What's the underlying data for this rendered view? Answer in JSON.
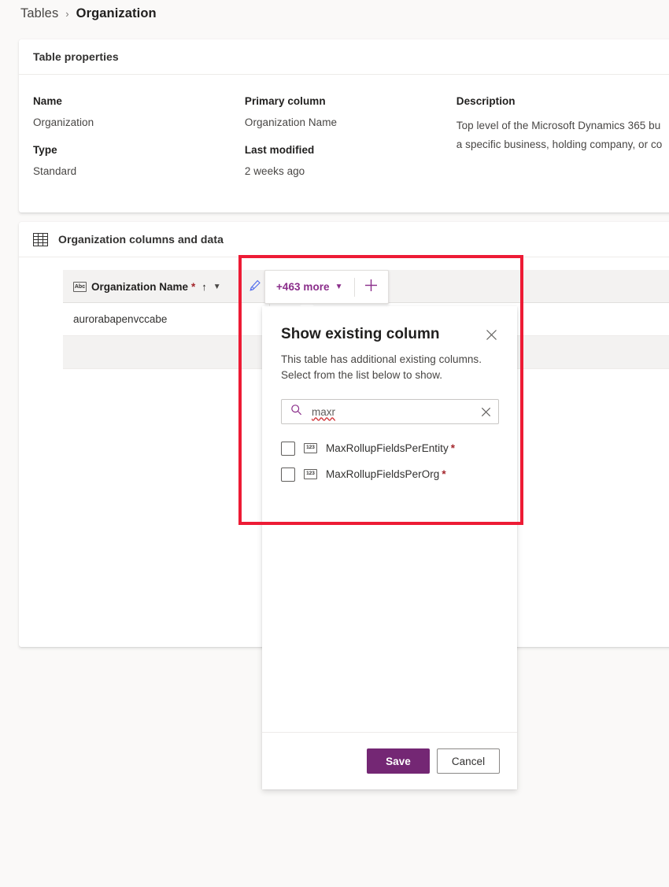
{
  "breadcrumb": {
    "parent": "Tables",
    "separator": "›",
    "current": "Organization"
  },
  "properties_card": {
    "title": "Table properties",
    "columns": [
      {
        "label": "Name",
        "value": "Organization",
        "label2": "Type",
        "value2": "Standard"
      },
      {
        "label": "Primary column",
        "value": "Organization Name",
        "label2": "Last modified",
        "value2": "2 weeks ago"
      }
    ],
    "description_label": "Description",
    "description_value": "Top level of the Microsoft Dynamics 365 bu\na specific business, holding company, or co"
  },
  "grid_card": {
    "title": "Organization columns and data",
    "table_icon": "table-icon",
    "header": {
      "name_icon": "abc-text-icon",
      "name_label": "Organization Name",
      "required_marker": "*",
      "sort_indicator": "↑",
      "chevron": "⌄",
      "edit_icon": "edit-pencil-icon"
    },
    "rows": [
      {
        "name": "aurorabapenvccabe"
      },
      {
        "name": ""
      }
    ]
  },
  "more_pill": {
    "label": "+463 more",
    "chevron_icon": "chevron-down-icon",
    "add_icon": "plus-icon"
  },
  "flyout": {
    "title": "Show existing column",
    "close_icon": "close-icon",
    "subtitle": "This table has additional existing columns. Select from the list below to show.",
    "search": {
      "icon": "search-icon",
      "value": "maxr",
      "placeholder": "Search",
      "clear_icon": "clear-icon"
    },
    "columns": [
      {
        "name": "MaxRollupFieldsPerEntity",
        "required_marker": "*",
        "type_icon": "number-123-icon",
        "checked": false
      },
      {
        "name": "MaxRollupFieldsPerOrg",
        "required_marker": "*",
        "type_icon": "number-123-icon",
        "checked": false
      }
    ],
    "save_label": "Save",
    "cancel_label": "Cancel"
  },
  "colors": {
    "accent_purple": "#742774",
    "link_purple": "#8a2d8a",
    "required_red": "#a4262c",
    "annotation_red": "#ed1b35",
    "page_bg": "#faf9f8"
  }
}
